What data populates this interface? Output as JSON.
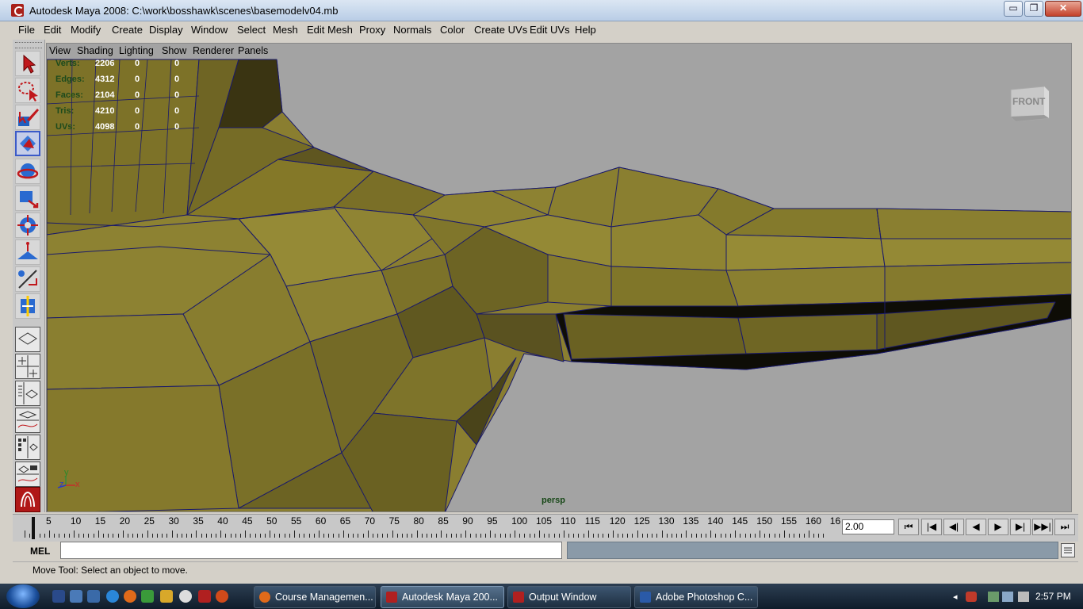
{
  "window": {
    "title": "Autodesk Maya 2008: C:\\work\\bosshawk\\scenes\\basemodelv04.mb",
    "min_glyph": "▭",
    "max_glyph": "❐",
    "close_glyph": "✕"
  },
  "menubar": {
    "items": [
      "File",
      "Edit",
      "Modify",
      "Create",
      "Display",
      "Window",
      "Select",
      "Mesh",
      "Edit Mesh",
      "Proxy",
      "Normals",
      "Color",
      "Create UVs",
      "Edit UVs",
      "Help"
    ]
  },
  "toolbox": {
    "tools": [
      "select-tool-icon",
      "lasso-tool-icon",
      "paint-select-tool-icon",
      "move-tool-icon",
      "rotate-tool-icon",
      "scale-tool-icon",
      "universal-manipulator-icon",
      "soft-modification-icon",
      "show-manipulator-icon",
      "last-tool-icon"
    ],
    "layouts": [
      "single-perspective-layout-icon",
      "four-view-layout-icon",
      "outliner-perspective-layout-icon",
      "graph-editor-layout-icon",
      "hypershade-layout-icon",
      "outliner-graph-layout-icon",
      "maya-logo-icon"
    ]
  },
  "panel": {
    "menus": [
      "View",
      "Shading",
      "Lighting",
      "Show",
      "Renderer",
      "Panels"
    ],
    "camera_label": "persp",
    "viewcube_label": "FRONT",
    "axis": {
      "y": "y",
      "z": "z",
      "x": "x"
    }
  },
  "hud": {
    "rows": [
      {
        "label": "Verts:",
        "v1": "2206",
        "v2": "0",
        "v3": "0"
      },
      {
        "label": "Edges:",
        "v1": "4312",
        "v2": "0",
        "v3": "0"
      },
      {
        "label": "Faces:",
        "v1": "2104",
        "v2": "0",
        "v3": "0"
      },
      {
        "label": "Tris:",
        "v1": "4210",
        "v2": "0",
        "v3": "0"
      },
      {
        "label": "UVs:",
        "v1": "4098",
        "v2": "0",
        "v3": "0"
      }
    ]
  },
  "timeline": {
    "labels": [
      "5",
      "10",
      "15",
      "20",
      "25",
      "30",
      "35",
      "40",
      "45",
      "50",
      "55",
      "60",
      "65",
      "70",
      "75",
      "80",
      "85",
      "90",
      "95",
      "100",
      "105",
      "110",
      "115",
      "120",
      "125",
      "130",
      "135",
      "140",
      "145",
      "150",
      "155",
      "160",
      "16"
    ],
    "current_frame": "2.00",
    "current_frame_value": 2,
    "buttons": [
      "⏮",
      "|◀",
      "◀|",
      "◀",
      "▶",
      "▶|",
      "▶▶|",
      "⏭"
    ]
  },
  "commandline": {
    "label": "MEL",
    "value": "",
    "help_text": "Move Tool: Select an object to move."
  },
  "taskbar": {
    "tasks": [
      {
        "label": "Course Managemen...",
        "color": "#e06a1a"
      },
      {
        "label": "Autodesk Maya 200...",
        "color": "#b02020"
      },
      {
        "label": "Output Window",
        "color": "#b02020"
      },
      {
        "label": "Adobe Photoshop C...",
        "color": "#2a5aa8"
      }
    ],
    "clock": "2:57 PM"
  },
  "colors": {
    "mesh_light": "#8b8030",
    "mesh_dark": "#5a5420",
    "viewport_bg": "#a3a3a3",
    "wire": "#1a1a6a"
  }
}
